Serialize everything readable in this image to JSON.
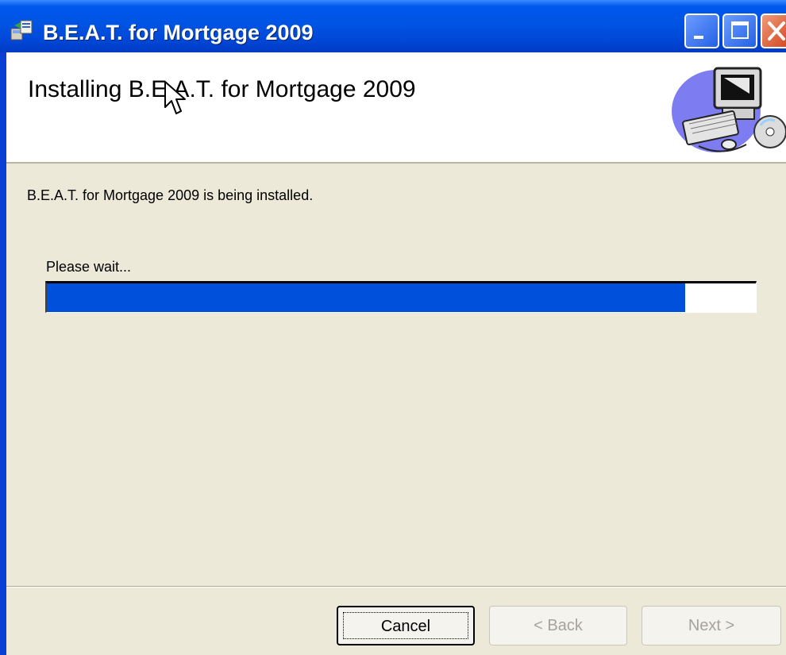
{
  "window": {
    "title": "B.E.A.T. for Mortgage 2009",
    "icons": [
      "installer-icon",
      "minimize-icon",
      "maximize-icon",
      "close-icon"
    ]
  },
  "header": {
    "title": "Installing B.E.A.T. for Mortgage 2009",
    "graphic": "computer-cd-icon"
  },
  "body": {
    "status": "B.E.A.T. for Mortgage 2009 is being installed.",
    "wait_label": "Please wait...",
    "progress": 0.9
  },
  "buttons": {
    "cancel": "Cancel",
    "back": "< Back",
    "next": "Next >"
  },
  "colors": {
    "titlebar": "#0054e3",
    "progress_fill": "#0050dc",
    "dialog_bg": "#ece9d8"
  }
}
